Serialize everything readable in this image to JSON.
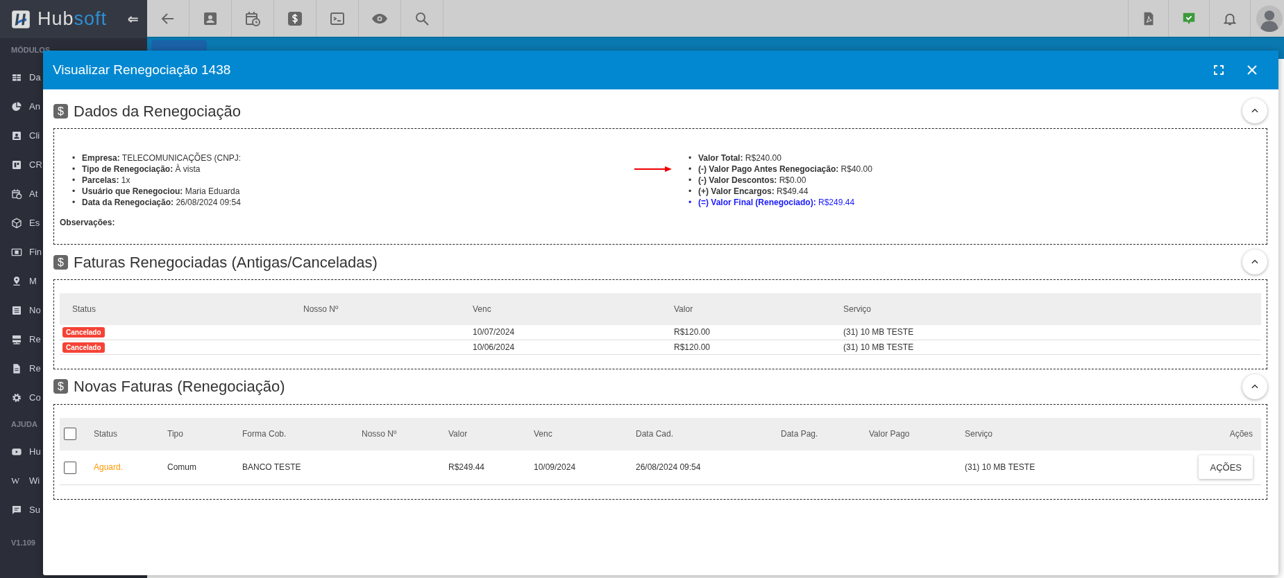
{
  "sidebar": {
    "logo": {
      "first": "Hub",
      "second": "soft"
    },
    "sections": [
      {
        "heading": "MÓDULOS",
        "items": [
          {
            "kind": "grid",
            "label": "Da"
          },
          {
            "kind": "pie",
            "label": "An"
          },
          {
            "kind": "contact",
            "label": "Cli"
          },
          {
            "kind": "board",
            "label": "CR"
          },
          {
            "kind": "calendar",
            "label": "At"
          },
          {
            "kind": "cube",
            "label": "Es"
          },
          {
            "kind": "money",
            "label": "Fin"
          },
          {
            "kind": "pin",
            "label": "M"
          },
          {
            "kind": "list",
            "label": "No"
          },
          {
            "kind": "server",
            "label": "Re"
          },
          {
            "kind": "file",
            "label": "Re"
          },
          {
            "kind": "gear",
            "label": "Co"
          }
        ]
      },
      {
        "heading": "AJUDA",
        "items": [
          {
            "kind": "video",
            "label": "Hu"
          },
          {
            "kind": "wiki",
            "glyph": "W",
            "label": "Wi"
          },
          {
            "kind": "chat",
            "label": "Su"
          }
        ]
      }
    ],
    "version": "V1.109"
  },
  "modal": {
    "title": "Visualizar Renegociação 1438",
    "sections": [
      {
        "kind": "details",
        "icon": "$",
        "title": "Dados da Renegociação",
        "bullet": "•",
        "left": [
          {
            "label": "Empresa:",
            "value": "TELECOMUNICAÇÕES (CNPJ:"
          },
          {
            "label": "Tipo de Renegociação:",
            "value": "À vista"
          },
          {
            "label": "Parcelas:",
            "value": "1x"
          },
          {
            "label": "Usuário que Renegociou:",
            "value": "Maria Eduarda"
          },
          {
            "label": "Data da Renegociação:",
            "value": "26/08/2024 09:54"
          }
        ],
        "notes_label": "Observações:",
        "right": [
          {
            "label": "Valor Total:",
            "value": "R$240.00",
            "highlighted": false,
            "arrow": false
          },
          {
            "label": "(-) Valor Pago Antes Renegociação:",
            "value": "R$40.00",
            "highlighted": false,
            "arrow": true
          },
          {
            "label": "(-) Valor Descontos:",
            "value": "R$0.00",
            "highlighted": false,
            "arrow": false
          },
          {
            "label": "(+) Valor Encargos:",
            "value": "R$49.44",
            "highlighted": false,
            "arrow": false
          },
          {
            "label": "(=) Valor Final (Renegociado):",
            "value": "R$249.44",
            "highlighted": true,
            "arrow": false
          }
        ]
      },
      {
        "kind": "table",
        "icon": "$",
        "title": "Faturas Renegociadas (Antigas/Canceladas)",
        "columns": [
          "Status",
          "Nosso Nº",
          "Venc",
          "Valor",
          "Serviço"
        ],
        "rows": [
          {
            "cells": [
              {
                "kind": "cancelled",
                "text": "Cancelado"
              },
              "",
              "10/07/2024",
              "R$120.00",
              "(31) 10 MB TESTE"
            ]
          },
          {
            "cells": [
              {
                "kind": "cancelled",
                "text": "Cancelado"
              },
              "",
              "10/06/2024",
              "R$120.00",
              "(31) 10 MB TESTE"
            ]
          }
        ]
      },
      {
        "kind": "table",
        "icon": "$",
        "title": "Novas Faturas (Renegociação)",
        "columns": [
          {
            "kind": "checkbox",
            "checked": false
          },
          "Status",
          "Tipo",
          "Forma Cob.",
          "Nosso Nº",
          "Valor",
          "Venc",
          "Data Cad.",
          "Data Pag.",
          "Valor Pago",
          "Serviço",
          "Ações"
        ],
        "rows": [
          {
            "cells": [
              {
                "kind": "checkbox",
                "checked": false
              },
              {
                "kind": "pending",
                "text": "Aguard."
              },
              "Comum",
              "BANCO TESTE",
              "",
              "R$249.44",
              "10/09/2024",
              "26/08/2024 09:54",
              "",
              "",
              "(31) 10 MB TESTE",
              {
                "kind": "button",
                "text": "AÇÕES"
              }
            ]
          }
        ]
      }
    ]
  }
}
